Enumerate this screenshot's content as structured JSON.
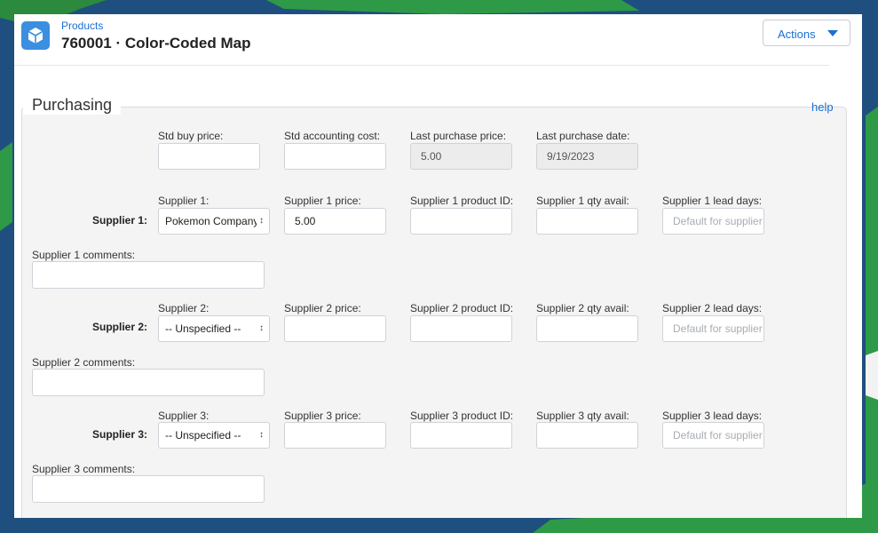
{
  "header": {
    "breadcrumb": "Products",
    "title": "760001 · Color-Coded Map",
    "actions_label": "Actions"
  },
  "section": {
    "title": "Purchasing",
    "help_label": "help"
  },
  "costs": {
    "std_buy_price": {
      "label": "Std buy price:",
      "value": ""
    },
    "std_accounting_cost": {
      "label": "Std accounting cost:",
      "value": ""
    },
    "last_purchase_price": {
      "label": "Last purchase price:",
      "value": "5.00"
    },
    "last_purchase_date": {
      "label": "Last purchase date:",
      "value": "9/19/2023"
    }
  },
  "suppliers": [
    {
      "row_label": "Supplier 1:",
      "supplier_label": "Supplier 1:",
      "supplier_value": "Pokemon Company",
      "price_label": "Supplier 1 price:",
      "price_value": "5.00",
      "product_id_label": "Supplier 1 product ID:",
      "product_id_value": "",
      "qty_label": "Supplier 1 qty avail:",
      "qty_value": "",
      "lead_label": "Supplier 1 lead days:",
      "lead_placeholder": "Default for supplier",
      "comments_label": "Supplier 1 comments:"
    },
    {
      "row_label": "Supplier 2:",
      "supplier_label": "Supplier 2:",
      "supplier_value": "-- Unspecified --",
      "price_label": "Supplier 2 price:",
      "price_value": "",
      "product_id_label": "Supplier 2 product ID:",
      "product_id_value": "",
      "qty_label": "Supplier 2 qty avail:",
      "qty_value": "",
      "lead_label": "Supplier 2 lead days:",
      "lead_placeholder": "Default for supplier",
      "comments_label": "Supplier 2 comments:"
    },
    {
      "row_label": "Supplier 3:",
      "supplier_label": "Supplier 3:",
      "supplier_value": "-- Unspecified --",
      "price_label": "Supplier 3 price:",
      "price_value": "",
      "product_id_label": "Supplier 3 product ID:",
      "product_id_value": "",
      "qty_label": "Supplier 3 qty avail:",
      "qty_value": "",
      "lead_label": "Supplier 3 lead days:",
      "lead_placeholder": "Default for supplier",
      "comments_label": "Supplier 3 comments:"
    }
  ],
  "icons": {
    "app": "cube-icon",
    "actions_caret": "caret-down-icon",
    "select_arrows": "updown-arrows-icon"
  },
  "colors": {
    "link": "#1a6fd4",
    "app_icon_bg": "#3b8ee0"
  }
}
